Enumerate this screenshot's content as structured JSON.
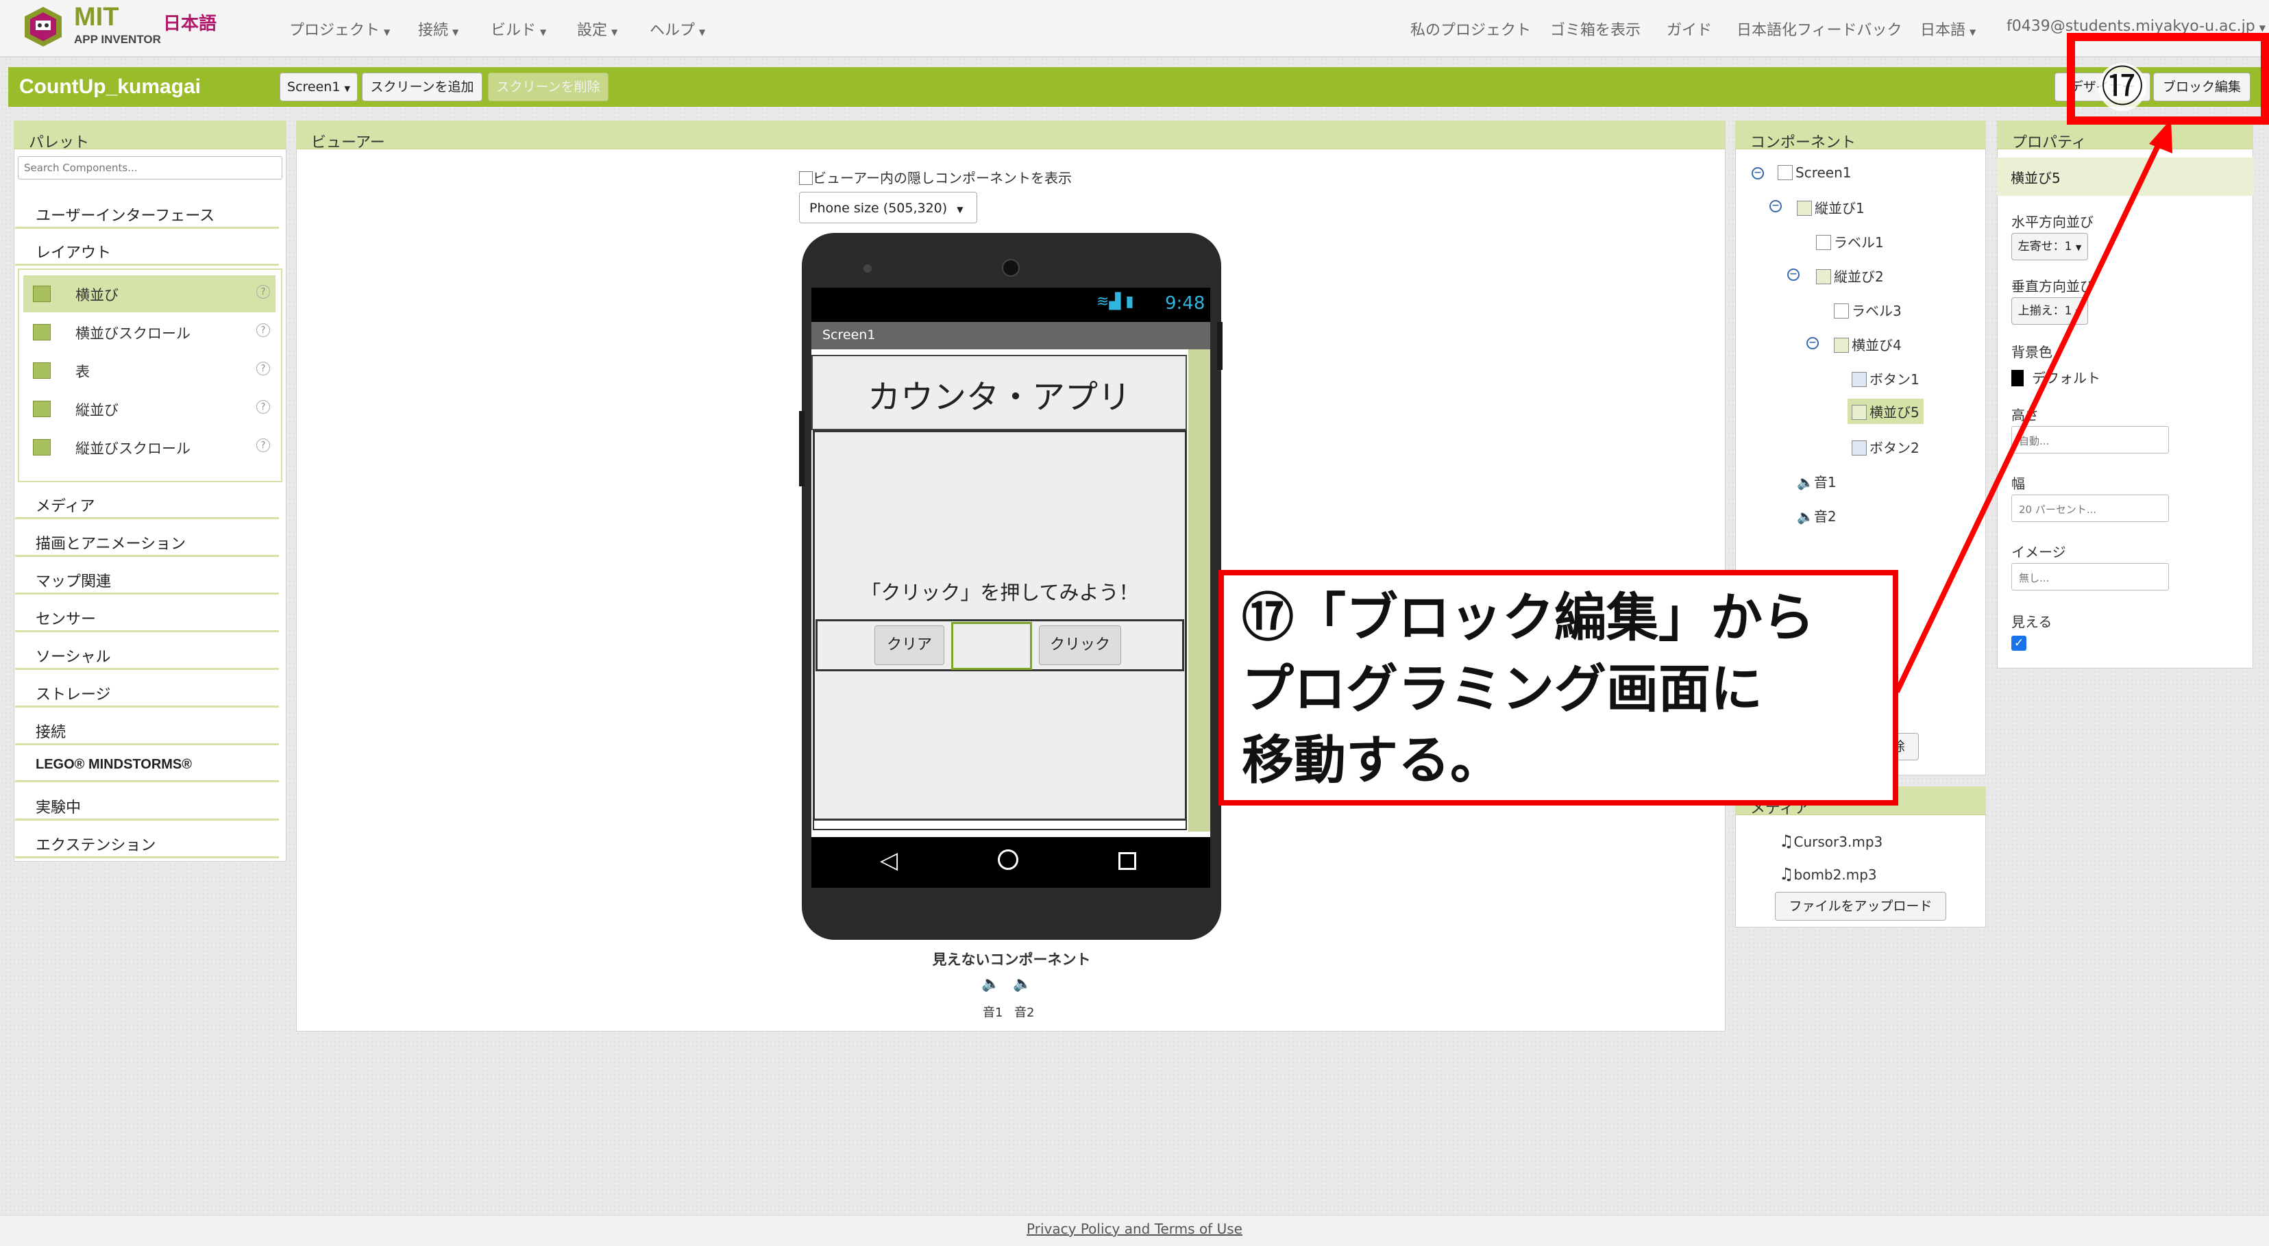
{
  "app": {
    "logo_mit": "MIT",
    "logo_sub": "APP INVENTOR",
    "logo_lang": "日本語"
  },
  "nav": {
    "left": [
      "プロジェクト",
      "接続",
      "ビルド",
      "設定",
      "ヘルプ"
    ],
    "right": [
      "私のプロジェクト",
      "ゴミ箱を表示",
      "ガイド",
      "日本語化フィードバック",
      "日本語",
      "f0439@students.miyakyo-u.ac.jp"
    ]
  },
  "projectbar": {
    "name": "CountUp_kumagai",
    "screen_select": "Screen1",
    "add_screen": "スクリーンを追加",
    "remove_screen": "スクリーンを削除",
    "designer": "デザイナー",
    "blocks": "ブロック編集"
  },
  "palette": {
    "title": "パレット",
    "search_placeholder": "Search Components...",
    "sections_top": [
      "ユーザーインターフェース",
      "レイアウト"
    ],
    "layout_items": [
      "横並び",
      "横並びスクロール",
      "表",
      "縦並び",
      "縦並びスクロール"
    ],
    "sections_bottom": [
      "メディア",
      "描画とアニメーション",
      "マップ関連",
      "センサー",
      "ソーシャル",
      "ストレージ",
      "接続",
      "LEGO® MINDSTORMS®",
      "実験中",
      "エクステンション"
    ]
  },
  "viewer": {
    "title": "ビューアー",
    "hidden_checkbox_label": "ビューアー内の隠しコンポーネントを表示",
    "phone_size": "Phone size (505,320)",
    "status_time": "9:48",
    "screen_title": "Screen1",
    "app_title": "カウンタ・アプリ",
    "prompt": "「クリック」を押してみよう！",
    "clear_button": "クリア",
    "click_button": "クリック",
    "nonvisible_label": "見えないコンポーネント",
    "nonvisible_items": [
      "音1",
      "音2"
    ]
  },
  "components": {
    "title": "コンポーネント",
    "tree": [
      "Screen1",
      "縦並び1",
      "ラベル1",
      "縦並び2",
      "ラベル3",
      "横並び4",
      "ボタン1",
      "横並び5",
      "ボタン2",
      "音1",
      "音2"
    ],
    "delete_btn_partial": "除"
  },
  "media": {
    "title_partial": "メディア",
    "files": [
      "Cursor3.mp3",
      "bomb2.mp3"
    ],
    "upload": "ファイルをアップロード"
  },
  "properties": {
    "title": "プロパティ",
    "component": "横並び5",
    "items": [
      {
        "label": "水平方向並び",
        "value": "左寄せ：1"
      },
      {
        "label": "垂直方向並び",
        "value": "上揃え：1"
      },
      {
        "label": "背景色",
        "value": "デフォルト"
      },
      {
        "label": "高さ",
        "value": "自動..."
      },
      {
        "label": "幅",
        "value": "20 パーセント..."
      },
      {
        "label": "イメージ",
        "value": "無し..."
      },
      {
        "label": "見える",
        "value": ""
      }
    ]
  },
  "annotation": {
    "step_marker": "⑰",
    "callout_line1": "⑰「ブロック編集」から",
    "callout_line2": "プログラミング画面に",
    "callout_line3": "移動する。"
  },
  "footer": {
    "link": "Privacy Policy and Terms of Use"
  },
  "colors": {
    "accent_green": "#9bbc2a",
    "panel_header": "#d6e3a8",
    "highlight_red": "#ff0000"
  }
}
